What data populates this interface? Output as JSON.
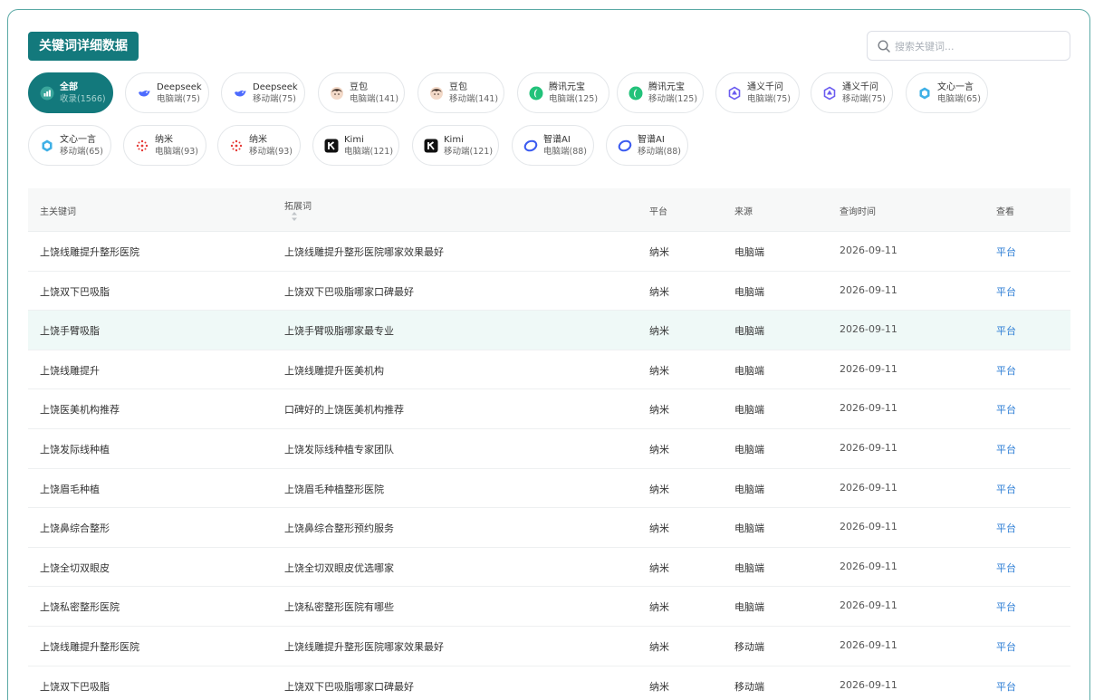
{
  "header": {
    "title": "关键词详细数据"
  },
  "search": {
    "placeholder": "搜索关键词..."
  },
  "chips": [
    {
      "name": "全部",
      "sub": "收录(1566)",
      "icon": "chart-icon",
      "active": true
    },
    {
      "name": "Deepseek",
      "sub": "电脑端(75)",
      "icon": "deepseek-icon"
    },
    {
      "name": "Deepseek",
      "sub": "移动端(75)",
      "icon": "deepseek-icon"
    },
    {
      "name": "豆包",
      "sub": "电脑端(141)",
      "icon": "doubao-icon"
    },
    {
      "name": "豆包",
      "sub": "移动端(141)",
      "icon": "doubao-icon"
    },
    {
      "name": "腾讯元宝",
      "sub": "电脑端(125)",
      "icon": "yuanbao-icon"
    },
    {
      "name": "腾讯元宝",
      "sub": "移动端(125)",
      "icon": "yuanbao-icon"
    },
    {
      "name": "通义千问",
      "sub": "电脑端(75)",
      "icon": "tongyi-icon"
    },
    {
      "name": "通义千问",
      "sub": "移动端(75)",
      "icon": "tongyi-icon"
    },
    {
      "name": "文心一言",
      "sub": "电脑端(65)",
      "icon": "wenxin-icon"
    },
    {
      "name": "文心一言",
      "sub": "移动端(65)",
      "icon": "wenxin-icon"
    },
    {
      "name": "纳米",
      "sub": "电脑端(93)",
      "icon": "nami-icon"
    },
    {
      "name": "纳米",
      "sub": "移动端(93)",
      "icon": "nami-icon"
    },
    {
      "name": "Kimi",
      "sub": "电脑端(121)",
      "icon": "kimi-icon"
    },
    {
      "name": "Kimi",
      "sub": "移动端(121)",
      "icon": "kimi-icon"
    },
    {
      "name": "智谱AI",
      "sub": "电脑端(88)",
      "icon": "zhipu-icon"
    },
    {
      "name": "智谱AI",
      "sub": "移动端(88)",
      "icon": "zhipu-icon"
    }
  ],
  "table": {
    "columns": [
      "主关键词",
      "拓展词",
      "平台",
      "来源",
      "查询时间",
      "查看"
    ],
    "rows": [
      [
        "上饶线雕提升整形医院",
        "上饶线雕提升整形医院哪家效果最好",
        "纳米",
        "电脑端",
        "2026-09-11",
        "平台"
      ],
      [
        "上饶双下巴吸脂",
        "上饶双下巴吸脂哪家口碑最好",
        "纳米",
        "电脑端",
        "2026-09-11",
        "平台"
      ],
      [
        "上饶手臂吸脂",
        "上饶手臂吸脂哪家最专业",
        "纳米",
        "电脑端",
        "2026-09-11",
        "平台"
      ],
      [
        "上饶线雕提升",
        "上饶线雕提升医美机构",
        "纳米",
        "电脑端",
        "2026-09-11",
        "平台"
      ],
      [
        "上饶医美机构推荐",
        "口碑好的上饶医美机构推荐",
        "纳米",
        "电脑端",
        "2026-09-11",
        "平台"
      ],
      [
        "上饶发际线种植",
        "上饶发际线种植专家团队",
        "纳米",
        "电脑端",
        "2026-09-11",
        "平台"
      ],
      [
        "上饶眉毛种植",
        "上饶眉毛种植整形医院",
        "纳米",
        "电脑端",
        "2026-09-11",
        "平台"
      ],
      [
        "上饶鼻综合整形",
        "上饶鼻综合整形预约服务",
        "纳米",
        "电脑端",
        "2026-09-11",
        "平台"
      ],
      [
        "上饶全切双眼皮",
        "上饶全切双眼皮优选哪家",
        "纳米",
        "电脑端",
        "2026-09-11",
        "平台"
      ],
      [
        "上饶私密整形医院",
        "上饶私密整形医院有哪些",
        "纳米",
        "电脑端",
        "2026-09-11",
        "平台"
      ],
      [
        "上饶线雕提升整形医院",
        "上饶线雕提升整形医院哪家效果最好",
        "纳米",
        "移动端",
        "2026-09-11",
        "平台"
      ],
      [
        "上饶双下巴吸脂",
        "上饶双下巴吸脂哪家口碑最好",
        "纳米",
        "移动端",
        "2026-09-11",
        "平台"
      ]
    ],
    "highlighted_row": 2
  },
  "colors": {
    "accent": "#13797c",
    "link": "#2f7fd6",
    "highlight": "#eff9f7"
  }
}
